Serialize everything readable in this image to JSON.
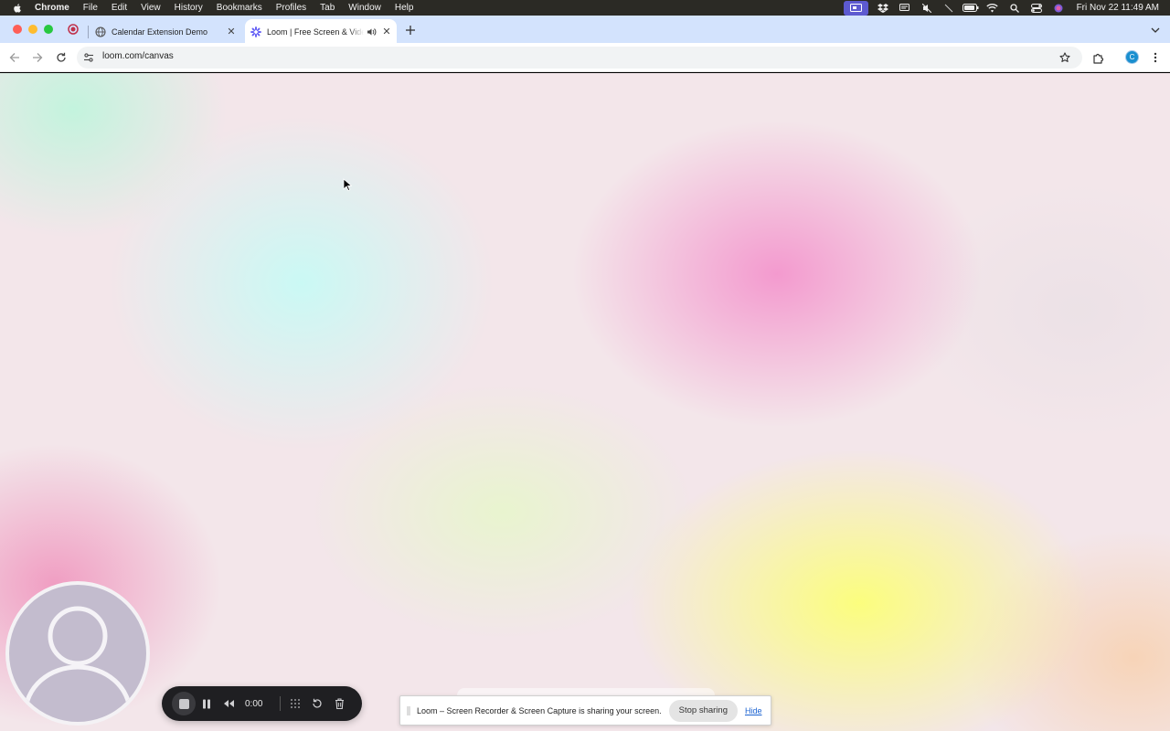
{
  "menubar": {
    "app_name": "Chrome",
    "items": [
      "File",
      "Edit",
      "View",
      "History",
      "Bookmarks",
      "Profiles",
      "Tab",
      "Window",
      "Help"
    ],
    "datetime": "Fri Nov 22  11:49 AM"
  },
  "tabs": [
    {
      "title": "Calendar Extension Demo",
      "icon": "globe-icon",
      "active": false
    },
    {
      "title": "Loom | Free Screen & Video Recording",
      "icon": "loom-icon",
      "active": true,
      "audio": true
    }
  ],
  "toolbar": {
    "url": "loom.com/canvas",
    "profile_initial": "C"
  },
  "recorder": {
    "timer": "0:00"
  },
  "sharing_bar": {
    "message": "Loom – Screen Recorder & Screen Capture is sharing your screen.",
    "stop_label": "Stop sharing",
    "hide_label": "Hide"
  },
  "colors": {
    "tabstrip": "#d3e3fd",
    "menubar": "#2b2a25",
    "recorder_bg": "#1f1f22",
    "link": "#1a62d1"
  }
}
